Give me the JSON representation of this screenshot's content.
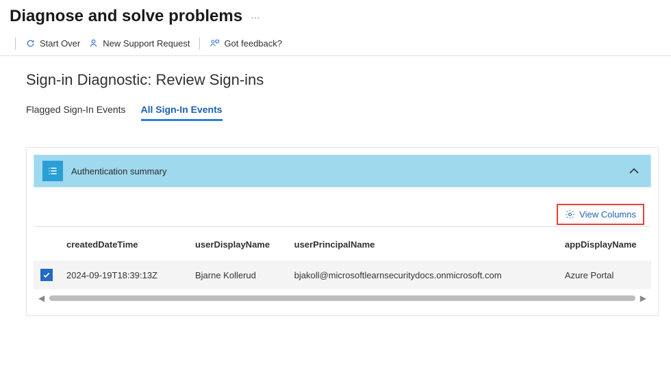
{
  "header": {
    "title": "Diagnose and solve problems",
    "ellipsis": "…"
  },
  "toolbar": {
    "start_over": "Start Over",
    "new_support": "New Support Request",
    "feedback": "Got feedback?"
  },
  "section": {
    "title": "Sign-in Diagnostic: Review Sign-ins"
  },
  "tabs": {
    "flagged": "Flagged Sign-In Events",
    "all": "All Sign-In Events"
  },
  "summary": {
    "label": "Authentication summary"
  },
  "actions": {
    "view_columns": "View Columns"
  },
  "table": {
    "headers": {
      "created": "createdDateTime",
      "userDisplay": "userDisplayName",
      "upn": "userPrincipalName",
      "app": "appDisplayName"
    },
    "rows": [
      {
        "checked": true,
        "created": "2024-09-19T18:39:13Z",
        "userDisplay": "Bjarne Kollerud",
        "upn": "bjakoll@microsoftlearnsecuritydocs.onmicrosoft.com",
        "app": "Azure Portal"
      }
    ]
  }
}
